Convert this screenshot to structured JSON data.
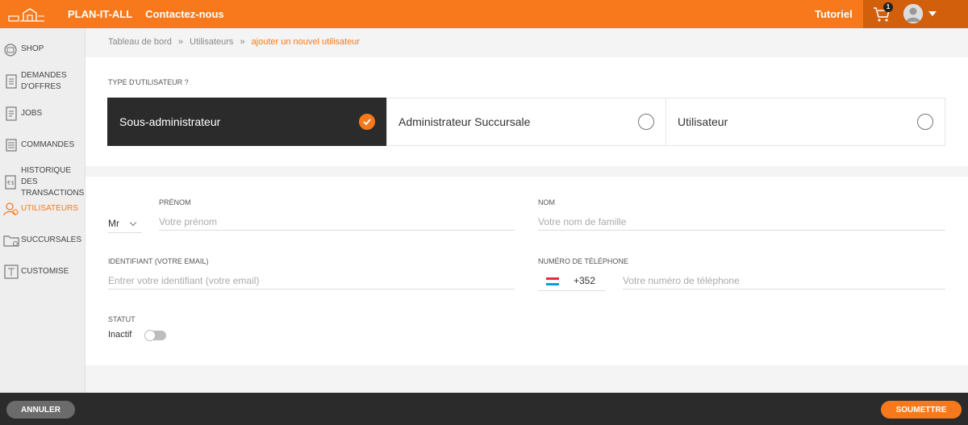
{
  "header": {
    "brand": "PLAN-IT-ALL",
    "contact": "Contactez-nous",
    "tutorial": "Tutoriel",
    "cart_count": "1"
  },
  "sidebar": {
    "items": [
      {
        "label": "SHOP",
        "icon": "shop-icon"
      },
      {
        "label": "DEMANDES D'OFFRES",
        "icon": "document-icon"
      },
      {
        "label": "JOBS",
        "icon": "document-icon"
      },
      {
        "label": "COMMANDES",
        "icon": "list-icon"
      },
      {
        "label": "HISTORIQUE DES TRANSACTIONS",
        "icon": "transaction-icon"
      },
      {
        "label": "UTILISATEURS",
        "icon": "users-icon",
        "active": true
      },
      {
        "label": "SUCCURSALES",
        "icon": "folder-icon"
      },
      {
        "label": "CUSTOMISE",
        "icon": "customise-icon"
      }
    ]
  },
  "breadcrumb": {
    "items": [
      "Tableau de bord",
      "Utilisateurs"
    ],
    "separator": "»",
    "current": "ajouter un nouvel utilisateur"
  },
  "user_type": {
    "label": "TYPE D'UTILISATEUR ?",
    "options": [
      {
        "label": "Sous-administrateur",
        "selected": true
      },
      {
        "label": "Administrateur Succursale",
        "selected": false
      },
      {
        "label": "Utilisateur",
        "selected": false
      }
    ]
  },
  "form": {
    "civility": "Mr",
    "firstname_label": "PRÉNOM",
    "firstname_placeholder": "Votre prénom",
    "lastname_label": "NOM",
    "lastname_placeholder": "Votre nom de famille",
    "email_label": "IDENTIFIANT (VOTRE EMAIL)",
    "email_placeholder": "Entrer votre identifiant (votre email)",
    "phone_label": "NUMÉRO DE TÉLÉPHONE",
    "phone_prefix": "+352",
    "phone_placeholder": "Votre numéro de téléphone",
    "status_label": "STATUT",
    "status_value": "Inactif",
    "status_on": false
  },
  "footer": {
    "cancel": "ANNULER",
    "submit": "SOUMETTRE"
  },
  "colors": {
    "accent": "#f7791c",
    "accent_dark": "#d25f0c",
    "dark": "#2b2b2b"
  }
}
